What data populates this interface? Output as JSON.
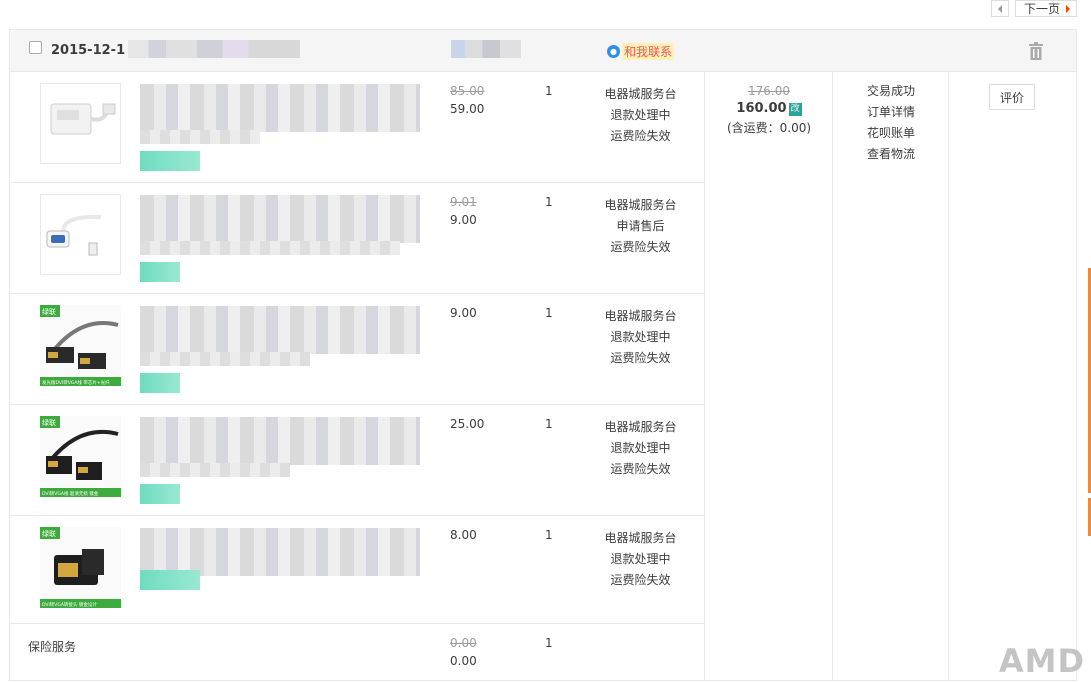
{
  "pager": {
    "next_label": "下一页"
  },
  "order": {
    "date": "2015-12-1",
    "contact_label": "和我联系",
    "total": {
      "original": "176.00",
      "amount": "160.00",
      "changed_badge": "改",
      "shipping_note": "(含运费：0.00)"
    },
    "status_links": [
      "交易成功",
      "订单详情",
      "花呗账单",
      "查看物流"
    ],
    "review_button": "评价",
    "items": [
      {
        "price_original": "85.00",
        "price": "59.00",
        "qty": "1",
        "services": [
          "电器城服务台",
          "退款处理中",
          "运费险失效"
        ]
      },
      {
        "price_original": "9.01",
        "price": "9.00",
        "qty": "1",
        "services": [
          "电器城服务台",
          "申请售后",
          "运费险失效"
        ]
      },
      {
        "price_original": "",
        "price": "9.00",
        "qty": "1",
        "services": [
          "电器城服务台",
          "退款处理中",
          "运费险失效"
        ]
      },
      {
        "price_original": "",
        "price": "25.00",
        "qty": "1",
        "services": [
          "电器城服务台",
          "退款处理中",
          "运费险失效"
        ]
      },
      {
        "price_original": "",
        "price": "8.00",
        "qty": "1",
        "services": [
          "电器城服务台",
          "退款处理中",
          "运费险失效"
        ]
      }
    ],
    "insurance": {
      "label": "保险服务",
      "price_original": "0.00",
      "price": "0.00",
      "qty": "1"
    }
  },
  "thumb_texts": [
    "绿联",
    "发光版DVI转VGA线 带芯片+光纤",
    "DVI转VGA线 超清无损 镀金",
    "DVI转VGA转接头 镀金设计"
  ],
  "watermark": "AMD",
  "colors": {
    "accent": "#ff4400",
    "badge": "#26a69a",
    "struck": "#9c9c9c"
  }
}
